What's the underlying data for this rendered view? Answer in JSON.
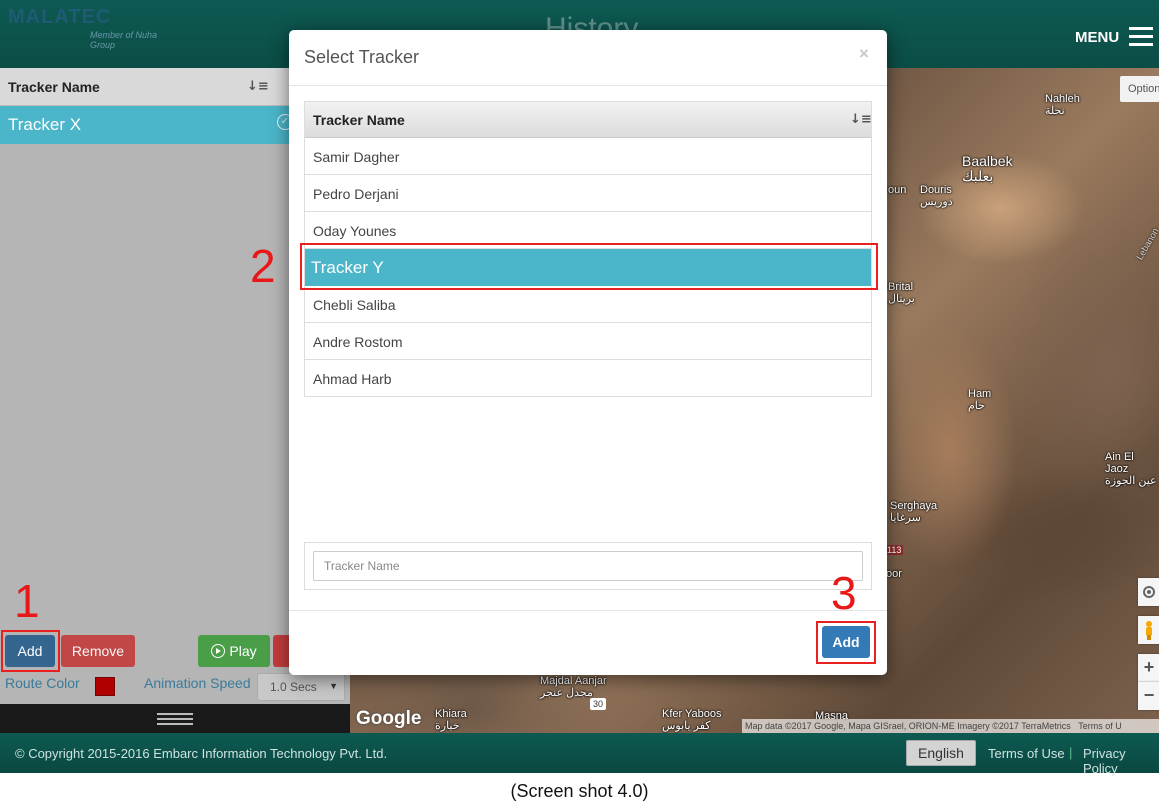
{
  "header": {
    "logo_text": "MALATEC",
    "logo_subtitle": "Member of Nuha Group",
    "title": "History",
    "menu_label": "MENU"
  },
  "left_panel": {
    "column_header": "Tracker Name",
    "selected_tracker": "Tracker X",
    "buttons": {
      "add": "Add",
      "remove": "Remove",
      "play": "Play"
    },
    "route_color_label": "Route Color",
    "route_color": "#b00000",
    "animation_speed_label": "Animation Speed",
    "animation_speed_value": "1.0 Secs"
  },
  "map": {
    "options_label": "Option",
    "towns": [
      "Nahleh",
      "نحلة",
      "Baalbek",
      "بعلبك",
      "Douris",
      "دوريس",
      "oun",
      "Brital",
      "بريتال",
      "Ham",
      "حام",
      "Ain El Jaoz",
      "عين الجوزة",
      "Serghaya",
      "سرغايا",
      "oor",
      "Majdal Aanjar",
      "مجدل عنجر",
      "Khiara",
      "خيارة",
      "Kfer Yaboos",
      "كفر يابوس",
      "Masna",
      "Lebanon"
    ],
    "road_badge": "113",
    "road_30": "30",
    "google_label": "Google",
    "attribution": "Map data ©2017 Google, Mapa GISrael, ORION-ME Imagery ©2017 TerraMetrics",
    "terms": "Terms of U",
    "zoom_in": "+",
    "zoom_out": "−"
  },
  "modal": {
    "title": "Select Tracker",
    "close": "×",
    "column_header": "Tracker Name",
    "rows": [
      "Samir Dagher",
      "Pedro Derjani",
      "Oday Younes",
      "Tracker Y",
      "Chebli Saliba",
      "Andre Rostom",
      "Ahmad Harb"
    ],
    "selected_index": 3,
    "search_placeholder": "Tracker Name",
    "add_button": "Add"
  },
  "footer": {
    "copyright": "© Copyright 2015-2016 Embarc Information Technology Pvt. Ltd.",
    "language": "English",
    "terms": "Terms of Use",
    "separator": "|",
    "privacy": "Privacy Policy"
  },
  "annotations": {
    "step1": "1",
    "step2": "2",
    "step3": "3",
    "highlight_color": "#e82020"
  },
  "caption": "(Screen shot 4.0)",
  "colors": {
    "header": "#0d5a52",
    "selected_row": "#4bb5c9",
    "primary_button": "#337ab7"
  }
}
